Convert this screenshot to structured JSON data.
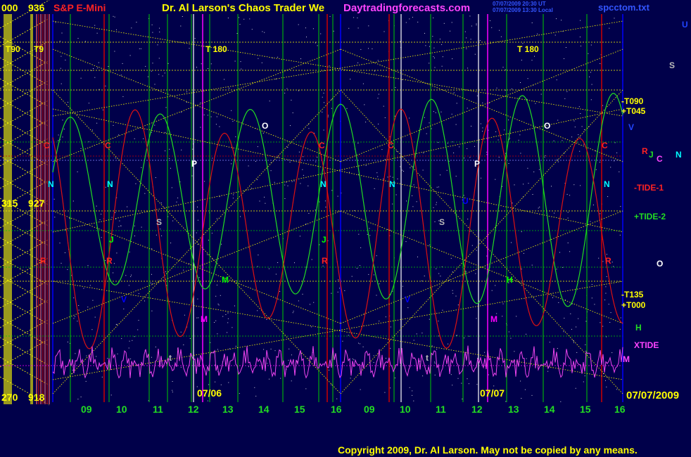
{
  "header": {
    "price_top_left": "000",
    "price_top": "936",
    "instrument": "S&P E-Mini",
    "title": "Dr. Al Larson's Chaos Trader We",
    "site": "Daytradingforecasts.com",
    "stamp_1": "07/07/2009 20:30 UT",
    "stamp_2": "07/07/2009 13:30 Local",
    "file": "spcctom.txt"
  },
  "left_scale": {
    "top": [
      "000",
      "936"
    ],
    "middle": [
      "315",
      "927"
    ],
    "bottom": [
      "270",
      "918"
    ],
    "t90_labels": [
      "T90",
      "T9"
    ]
  },
  "right_labels": {
    "u": "U",
    "s": "S",
    "t090": "-T090",
    "t045": "+T045",
    "v": "V",
    "r": "R",
    "j": "J",
    "c": "C",
    "n": "N",
    "tide1": "-TIDE-1",
    "tide2": "+TIDE-2",
    "o": "O",
    "t135": "-T135",
    "t000": "+T000",
    "h": "H",
    "xtide": "XTIDE",
    "m": "M",
    "date": "07/07/2009"
  },
  "top_labels": [
    "T 180",
    "T 180"
  ],
  "date_labels": [
    "07/06",
    "07/07"
  ],
  "footer": "Copyright 2009, Dr. Al Larson. May not be copied by any means.",
  "colors": {
    "background": "#00004a",
    "grid_yellow": "#ffff00",
    "grid_green": "#00cc00",
    "grid_red": "#cc0000",
    "grid_blue": "#0000ff",
    "grid_magenta": "#ff00ff",
    "line_green": "#22dd22",
    "line_red": "#dd1111",
    "line_magenta": "#ee44ee",
    "hour_label": "#22dd22"
  },
  "chart_data": {
    "type": "line",
    "x_axis_labels": [
      "09",
      "10",
      "11",
      "12",
      "13",
      "14",
      "15",
      "16",
      "09",
      "10",
      "11",
      "12",
      "13",
      "14",
      "15",
      "16"
    ],
    "series": [],
    "planet_labels": [
      {
        "text": "C",
        "color": "#ff2222"
      },
      {
        "text": "C",
        "color": "#ff2222"
      },
      {
        "text": "C",
        "color": "#ff2222"
      },
      {
        "text": "C",
        "color": "#ff2222"
      },
      {
        "text": "C",
        "color": "#ff2222"
      },
      {
        "text": "N",
        "color": "#00ffff"
      },
      {
        "text": "N",
        "color": "#00ffff"
      },
      {
        "text": "N",
        "color": "#00ffff"
      },
      {
        "text": "N",
        "color": "#00ffff"
      },
      {
        "text": "N",
        "color": "#00ffff"
      },
      {
        "text": "R",
        "color": "#ff2222"
      },
      {
        "text": "R",
        "color": "#ff2222"
      },
      {
        "text": "R",
        "color": "#ff2222"
      },
      {
        "text": "R",
        "color": "#ff2222"
      },
      {
        "text": "O",
        "color": "#ffffff"
      },
      {
        "text": "O",
        "color": "#ffffff"
      },
      {
        "text": "P",
        "color": "#ffffff"
      },
      {
        "text": "P",
        "color": "#ffffff"
      },
      {
        "text": "S",
        "color": "#bbbbbb"
      },
      {
        "text": "S",
        "color": "#bbbbbb"
      },
      {
        "text": "M",
        "color": "#00ff00"
      },
      {
        "text": "M",
        "color": "#ff00ff"
      },
      {
        "text": "M",
        "color": "#ff00ff"
      },
      {
        "text": "H",
        "color": "#00ff00"
      },
      {
        "text": "V",
        "color": "#0000ff"
      },
      {
        "text": "V",
        "color": "#0000ff"
      },
      {
        "text": "U",
        "color": "#0000ff"
      },
      {
        "text": "J",
        "color": "#00ff00"
      },
      {
        "text": "J",
        "color": "#00ff00"
      },
      {
        "text": "t",
        "color": "#bbbbbb"
      },
      {
        "text": "t",
        "color": "#bbbbbb"
      }
    ]
  }
}
